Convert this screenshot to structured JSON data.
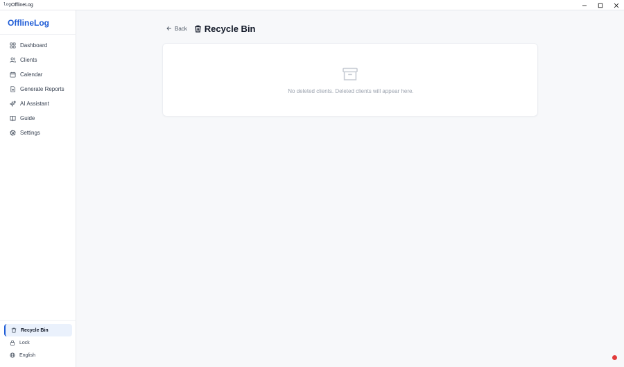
{
  "window": {
    "title": "OfflineLog",
    "app_icon_text": "log"
  },
  "sidebar": {
    "brand": "OfflineLog",
    "items": [
      {
        "label": "Dashboard",
        "icon": "dashboard-icon"
      },
      {
        "label": "Clients",
        "icon": "users-icon"
      },
      {
        "label": "Calendar",
        "icon": "calendar-icon"
      },
      {
        "label": "Generate Reports",
        "icon": "file-text-icon"
      },
      {
        "label": "AI Assistant",
        "icon": "sparkles-icon"
      },
      {
        "label": "Guide",
        "icon": "book-icon"
      },
      {
        "label": "Settings",
        "icon": "gear-icon"
      }
    ],
    "bottom": {
      "recycle_bin": "Recycle Bin",
      "lock": "Lock",
      "language": "English"
    }
  },
  "header": {
    "back_label": "Back",
    "title": "Recycle Bin"
  },
  "empty_state": {
    "message": "No deleted clients. Deleted clients will appear here.",
    "icon": "archive-icon"
  },
  "colors": {
    "brand": "#1d5bd6",
    "active_bg": "#eaf1fc",
    "page_bg": "#f7f8fa",
    "recording_dot": "#e23b3b"
  }
}
